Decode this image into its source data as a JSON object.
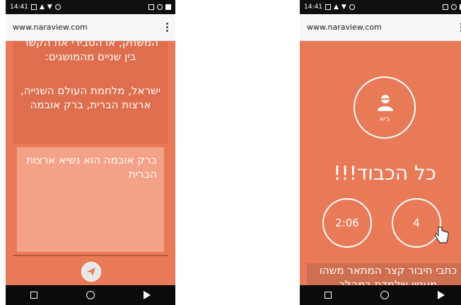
{
  "left_phone": {
    "status_time": "14:41",
    "url": "www.naraview.com",
    "question_prefix": "המשחק, או הסבירי את הקשר בין שניים מהמושגים:",
    "concepts": "ישראל, מלחמת העולם השנייה, ארצות הברית, ברק אובמה",
    "answer": "ברק אובמה הוא נשיא ארצות הברית",
    "send_icon": "send-icon"
  },
  "right_phone": {
    "status_time": "14:41",
    "url": "www.naraview.com",
    "avatar_name": "ג'יא",
    "congrats": "כל הכבוד!!!",
    "timer": "2:06",
    "score": "4",
    "prompt": "כתבי חיבור קצר המתאר משהו מעניין שלמדת במהלך"
  },
  "colors": {
    "accent": "#e97a58",
    "card_dark": "#df6e4e",
    "card_light": "#f4a287"
  }
}
